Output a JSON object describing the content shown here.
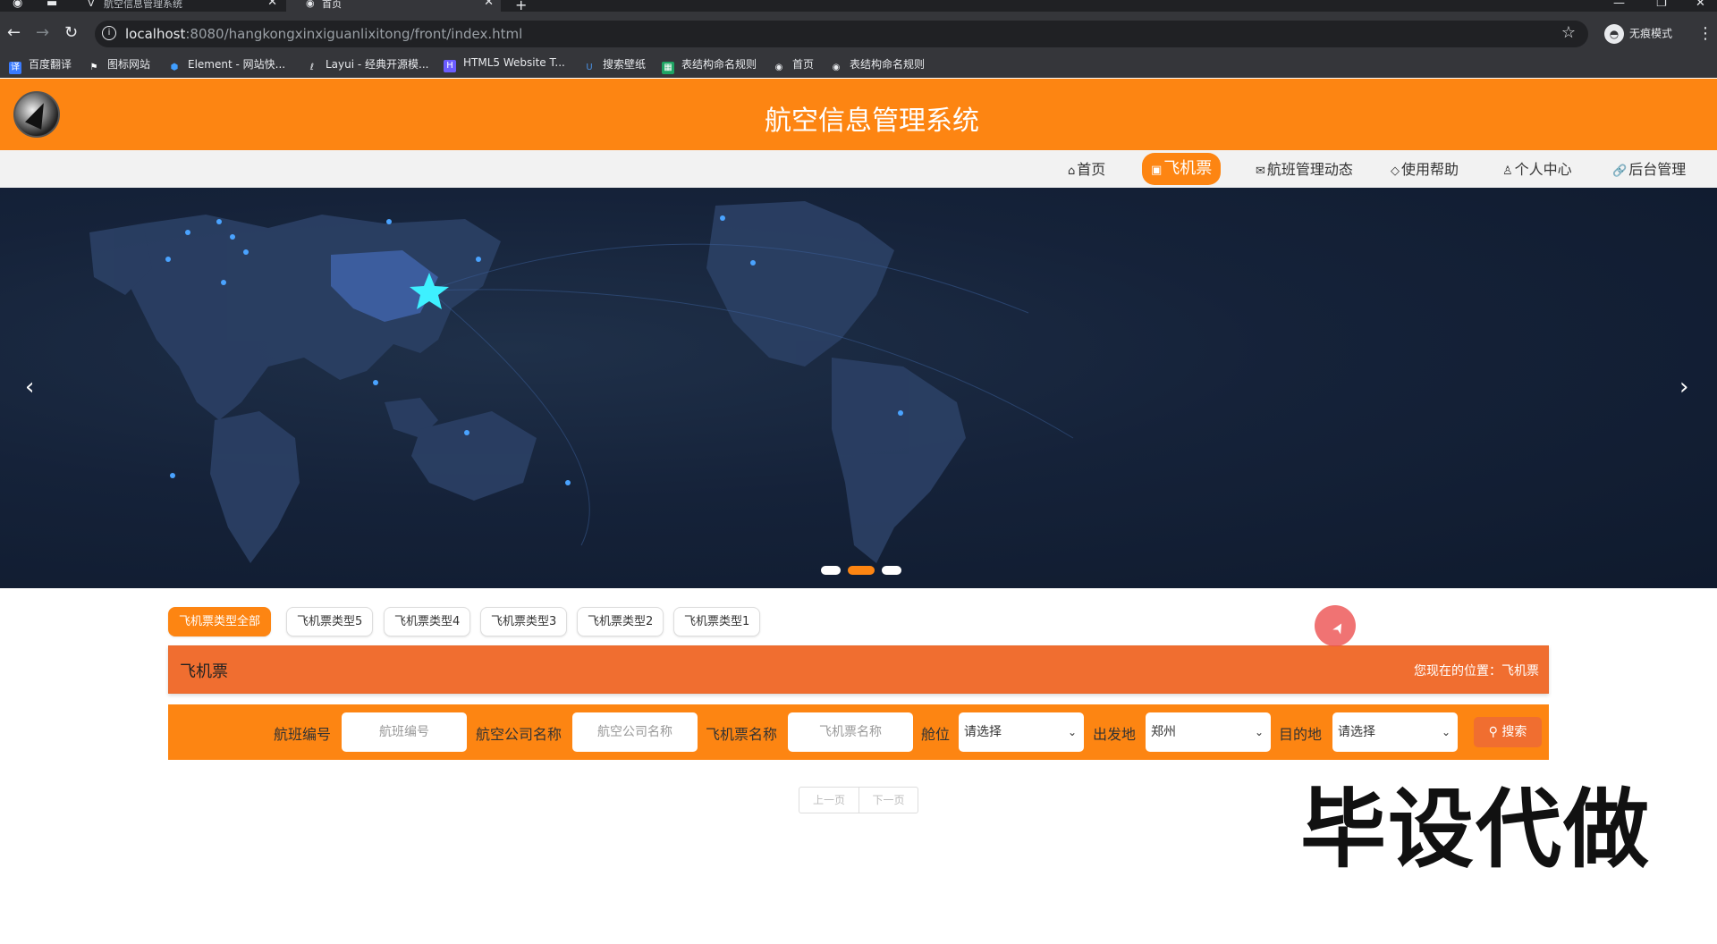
{
  "browser": {
    "tabs": [
      {
        "title": "航空信息管理系统",
        "active": false
      },
      {
        "title": "首页",
        "active": true
      }
    ],
    "url_host": "localhost",
    "url_rest": ":8080/hangkongxinxiguanlixitong/front/index.html",
    "profile_label": "无痕模式",
    "bookmarks": [
      {
        "label": "百度翻译",
        "icon": "translate-icon",
        "color": "#3a7bff"
      },
      {
        "label": "图标网站",
        "icon": "flag-icon",
        "color": "#ffffff"
      },
      {
        "label": "Element - 网站快...",
        "icon": "element-icon",
        "color": "#409eff"
      },
      {
        "label": "Layui - 经典开源模...",
        "icon": "layui-icon",
        "color": "#e8eaed"
      },
      {
        "label": "HTML5 Website T...",
        "icon": "html5-icon",
        "color": "#6b5cff"
      },
      {
        "label": "搜索壁纸",
        "icon": "wallpaper-icon",
        "color": "#4a90e2"
      },
      {
        "label": "表结构命名规则",
        "icon": "sheet-icon",
        "color": "#1fa463"
      },
      {
        "label": "首页",
        "icon": "globe-icon",
        "color": "#e8eaed"
      },
      {
        "label": "表结构命名规则",
        "icon": "globe-icon",
        "color": "#e8eaed"
      }
    ]
  },
  "site": {
    "title": "航空信息管理系统",
    "brand_color": "#fd8512",
    "nav": [
      {
        "label": "首页",
        "icon": "home-icon",
        "active": false
      },
      {
        "label": "飞机票",
        "icon": "ticket-icon",
        "active": true
      },
      {
        "label": "航班管理动态",
        "icon": "mail-icon",
        "active": false
      },
      {
        "label": "使用帮助",
        "icon": "tag-icon",
        "active": false
      },
      {
        "label": "个人中心",
        "icon": "user-icon",
        "active": false
      },
      {
        "label": "后台管理",
        "icon": "link-icon",
        "active": false
      }
    ]
  },
  "banner": {
    "slides_count": 3,
    "active_index": 1
  },
  "categories": [
    {
      "label": "飞机票类型全部",
      "active": true
    },
    {
      "label": "飞机票类型5",
      "active": false
    },
    {
      "label": "飞机票类型4",
      "active": false
    },
    {
      "label": "飞机票类型3",
      "active": false
    },
    {
      "label": "飞机票类型2",
      "active": false
    },
    {
      "label": "飞机票类型1",
      "active": false
    }
  ],
  "section": {
    "title": "飞机票",
    "location_label": "您现在的位置：",
    "location_value": "飞机票"
  },
  "filters": {
    "flight_no_label": "航班编号",
    "flight_no_placeholder": "航班编号",
    "airline_label": "航空公司名称",
    "airline_placeholder": "航空公司名称",
    "ticket_label": "飞机票名称",
    "ticket_placeholder": "飞机票名称",
    "cabin_label": "舱位",
    "cabin_value": "请选择",
    "depart_label": "出发地",
    "depart_value": "郑州",
    "dest_label": "目的地",
    "dest_value": "请选择",
    "search_label": "搜索"
  },
  "pager": {
    "prev": "上一页",
    "next": "下一页"
  },
  "watermark": "毕设代做"
}
